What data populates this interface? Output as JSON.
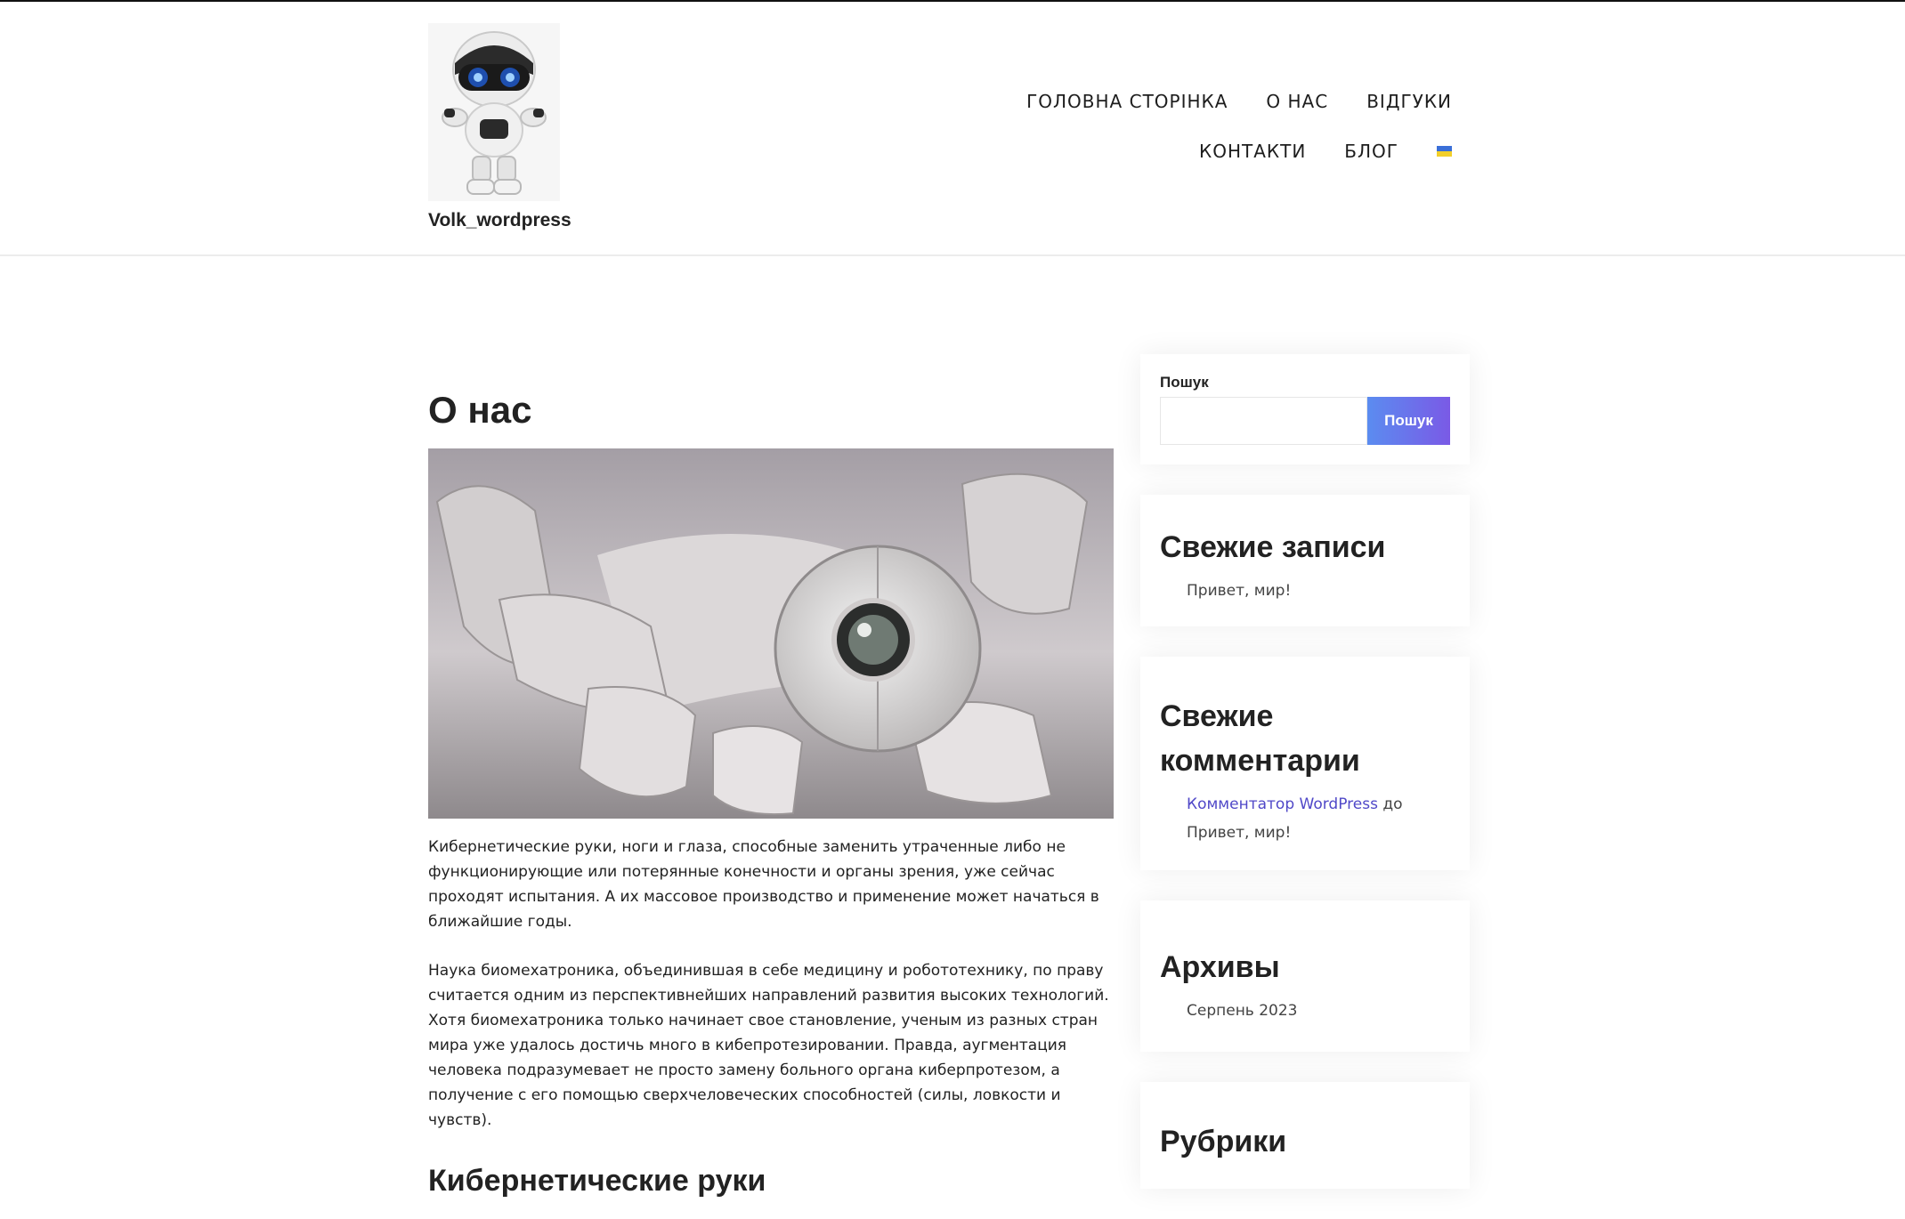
{
  "site": {
    "name": "Volk_wordpress"
  },
  "nav": {
    "row1": [
      "ГОЛОВНА СТОРІНКА",
      "О НАС",
      "ВІДГУКИ"
    ],
    "row2": [
      "КОНТАКТИ",
      "БЛОГ"
    ],
    "language_flag": {
      "icon": "ukraine-flag-icon",
      "colors": [
        "#3a6fd8",
        "#f2cf2a"
      ]
    }
  },
  "main": {
    "title": "О нас",
    "paragraphs": [
      "Кибернетические руки, ноги и глаза, способные заменить утраченные либо не функционирующие или потерянные конечности и органы зрения, уже сейчас проходят испытания. А их массовое производство и применение может начаться в ближайшие годы.",
      "Наука биомехатроника, объединившая в себе медицину и робототехнику, по праву считается одним из перспективнейших направлений развития высоких технологий. Хотя биомехатроника только начинает свое становление, ученым из разных стран мира уже удалось достичь много в кибепротезировании. Правда, аугментация человека подразумевает не просто замену больного органа киберпротезом, а получение с его помощью сверхчеловеческих способностей (силы, ловкости и чувств)."
    ],
    "subtitle": "Кибернетические руки"
  },
  "sidebar": {
    "search": {
      "label": "Пошук",
      "button": "Пошук",
      "value": ""
    },
    "recent_posts": {
      "title": "Свежие записи",
      "items": [
        "Привет, мир!"
      ]
    },
    "recent_comments": {
      "title": "Свежие комментарии",
      "author": "Комментатор WordPress",
      "connector": "до",
      "post": "Привет, мир!"
    },
    "archives": {
      "title": "Архивы",
      "items": [
        "Серпень 2023"
      ]
    },
    "categories": {
      "title": "Рубрики"
    }
  },
  "colors": {
    "accent_link": "#5048c8",
    "button_gradient": [
      "#5b8cf0",
      "#7a5ae6"
    ]
  }
}
